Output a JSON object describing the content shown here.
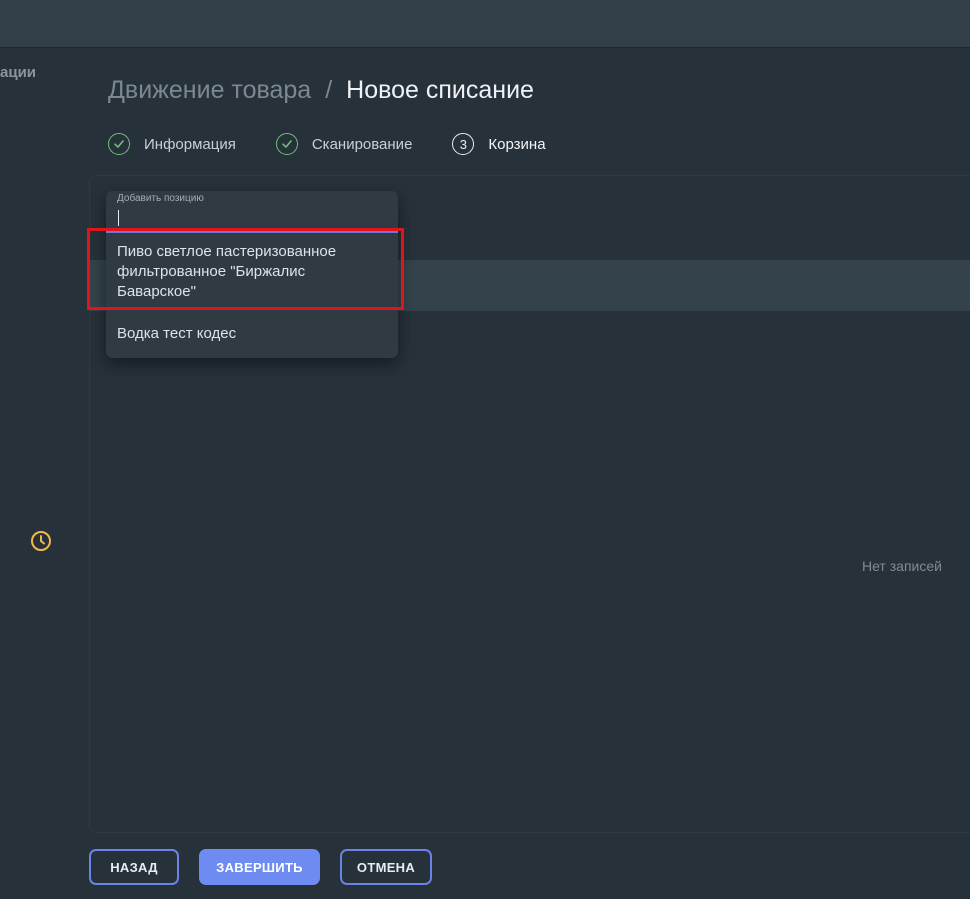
{
  "sidebar": {
    "partial_label": "ации"
  },
  "breadcrumb": {
    "parent": "Движение товара",
    "separator": "/",
    "current": "Новое списание"
  },
  "stepper": {
    "steps": [
      {
        "label": "Информация",
        "state": "done",
        "icon": "check-icon"
      },
      {
        "label": "Сканирование",
        "state": "done",
        "icon": "check-icon"
      },
      {
        "label": "Корзина",
        "state": "active",
        "number": "3"
      }
    ]
  },
  "autocomplete": {
    "label": "Добавить позицию",
    "value": "",
    "options": [
      "Пиво светлое пастеризованное фильтрованное \"Биржалис Баварское\"",
      "Водка тест кодес"
    ]
  },
  "table": {
    "empty_text": "Нет записей"
  },
  "actions": {
    "back": "НАЗАД",
    "finish": "ЗАВЕРШИТЬ",
    "cancel": "ОТМЕНА"
  },
  "colors": {
    "background": "#27313a",
    "topbar": "#323f48",
    "accent": "#6d8bf0",
    "success": "#6fbf78",
    "warning_icon": "#f2b94a",
    "highlight": "#e0141a"
  }
}
